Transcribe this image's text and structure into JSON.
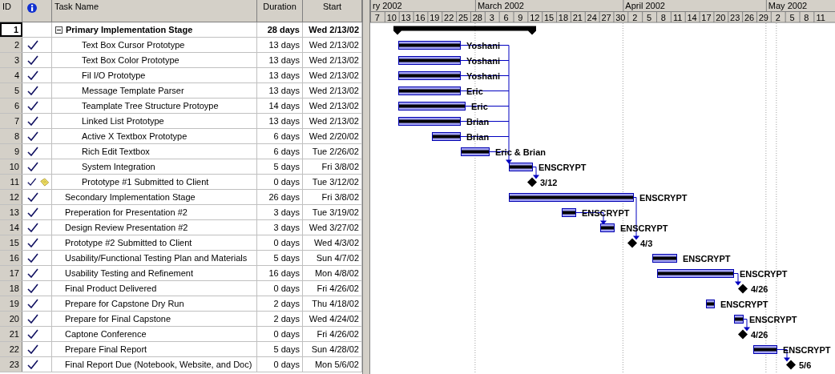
{
  "columns": {
    "id": "ID",
    "name": "Task Name",
    "duration": "Duration",
    "start": "Start"
  },
  "timescale": {
    "months": [
      "ry 2002",
      "March 2002",
      "April 2002",
      "May 2002"
    ],
    "days": [
      "7",
      "10",
      "13",
      "16",
      "19",
      "22",
      "25",
      "28",
      "3",
      "6",
      "9",
      "12",
      "15",
      "18",
      "21",
      "24",
      "27",
      "30",
      "2",
      "5",
      "8",
      "11",
      "14",
      "17",
      "20",
      "23",
      "26",
      "29",
      "2",
      "5",
      "8",
      "11"
    ]
  },
  "tasks": [
    {
      "id": "1",
      "name": "Primary Implementation Stage",
      "duration": "28 days",
      "start": "Wed 2/13/02",
      "kind": "summary",
      "selected": true,
      "complete": false,
      "note": false,
      "expanded": true,
      "children": [
        {
          "id": "2",
          "name": "Text Box Cursor Prototype",
          "duration": "13 days",
          "start": "Wed 2/13/02",
          "kind": "task",
          "selected": false,
          "complete": true,
          "note": false,
          "bar_label": "Yoshani"
        },
        {
          "id": "3",
          "name": "Text Box Color Prototype",
          "duration": "13 days",
          "start": "Wed 2/13/02",
          "kind": "task",
          "selected": false,
          "complete": true,
          "note": false,
          "bar_label": "Yoshani"
        },
        {
          "id": "4",
          "name": "Fil I/O Prototype",
          "duration": "13 days",
          "start": "Wed 2/13/02",
          "kind": "task",
          "selected": false,
          "complete": true,
          "note": false,
          "bar_label": "Yoshani"
        },
        {
          "id": "5",
          "name": "Message Template Parser",
          "duration": "13 days",
          "start": "Wed 2/13/02",
          "kind": "task",
          "selected": false,
          "complete": true,
          "note": false,
          "bar_label": "Eric"
        },
        {
          "id": "6",
          "name": "Teamplate Tree Structure Protoype",
          "duration": "14 days",
          "start": "Wed 2/13/02",
          "kind": "task",
          "selected": false,
          "complete": true,
          "note": false,
          "bar_label": "Eric"
        },
        {
          "id": "7",
          "name": "Linked List Prototype",
          "duration": "13 days",
          "start": "Wed 2/13/02",
          "kind": "task",
          "selected": false,
          "complete": true,
          "note": false,
          "bar_label": "Brian"
        },
        {
          "id": "8",
          "name": "Active X Textbox Prototype",
          "duration": "6 days",
          "start": "Wed 2/20/02",
          "kind": "task",
          "selected": false,
          "complete": true,
          "note": false,
          "bar_label": "Brian"
        },
        {
          "id": "9",
          "name": "Rich Edit Textbox",
          "duration": "6 days",
          "start": "Tue 2/26/02",
          "kind": "task",
          "selected": false,
          "complete": true,
          "note": false,
          "bar_label": "Eric & Brian"
        },
        {
          "id": "10",
          "name": "System Integration",
          "duration": "5 days",
          "start": "Fri 3/8/02",
          "kind": "task",
          "selected": false,
          "complete": true,
          "note": false,
          "bar_label": "ENSCRYPT"
        },
        {
          "id": "11",
          "name": "Prototype #1 Submitted to Client",
          "duration": "0 days",
          "start": "Tue 3/12/02",
          "kind": "milestone",
          "selected": false,
          "complete": true,
          "note": true,
          "bar_label": "3/12"
        }
      ]
    },
    {
      "id": "12",
      "name": "Secondary Implementation Stage",
      "duration": "26 days",
      "start": "Fri 3/8/02",
      "kind": "task",
      "selected": false,
      "complete": true,
      "note": false,
      "bar_label": "ENSCRYPT"
    },
    {
      "id": "13",
      "name": "Preperation for Presentation #2",
      "duration": "3 days",
      "start": "Tue 3/19/02",
      "kind": "task",
      "selected": false,
      "complete": true,
      "note": false,
      "bar_label": "ENSCRYPT"
    },
    {
      "id": "14",
      "name": "Design Review Presentation #2",
      "duration": "3 days",
      "start": "Wed 3/27/02",
      "kind": "task",
      "selected": false,
      "complete": true,
      "note": false,
      "bar_label": "ENSCRYPT"
    },
    {
      "id": "15",
      "name": "Prototype #2 Submitted to Client",
      "duration": "0 days",
      "start": "Wed 4/3/02",
      "kind": "milestone",
      "selected": false,
      "complete": true,
      "note": false,
      "bar_label": "4/3"
    },
    {
      "id": "16",
      "name": "Usability/Functional Testing Plan and Materials",
      "duration": "5 days",
      "start": "Sun 4/7/02",
      "kind": "task",
      "selected": false,
      "complete": true,
      "note": false,
      "bar_label": "ENSCRYPT"
    },
    {
      "id": "17",
      "name": "Usability Testing and Refinement",
      "duration": "16 days",
      "start": "Mon 4/8/02",
      "kind": "task",
      "selected": false,
      "complete": true,
      "note": false,
      "bar_label": "ENSCRYPT"
    },
    {
      "id": "18",
      "name": "Final Product Delivered",
      "duration": "0 days",
      "start": "Fri 4/26/02",
      "kind": "milestone",
      "selected": false,
      "complete": true,
      "note": false,
      "bar_label": "4/26"
    },
    {
      "id": "19",
      "name": "Prepare for Capstone Dry Run",
      "duration": "2 days",
      "start": "Thu 4/18/02",
      "kind": "task",
      "selected": false,
      "complete": true,
      "note": false,
      "bar_label": "ENSCRYPT"
    },
    {
      "id": "20",
      "name": "Prepare for Final Capstone",
      "duration": "2 days",
      "start": "Wed 4/24/02",
      "kind": "task",
      "selected": false,
      "complete": true,
      "note": false,
      "bar_label": "ENSCRYPT"
    },
    {
      "id": "21",
      "name": "Captone Conference",
      "duration": "0 days",
      "start": "Fri 4/26/02",
      "kind": "milestone",
      "selected": false,
      "complete": true,
      "note": false,
      "bar_label": "4/26"
    },
    {
      "id": "22",
      "name": "Prepare Final Report",
      "duration": "5 days",
      "start": "Sun 4/28/02",
      "kind": "task",
      "selected": false,
      "complete": true,
      "note": false,
      "bar_label": "ENSCRYPT"
    },
    {
      "id": "23",
      "name": "Final Report Due (Notebook, Website, and Doc)",
      "duration": "0 days",
      "start": "Mon 5/6/02",
      "kind": "milestone",
      "selected": false,
      "complete": true,
      "note": false,
      "bar_label": "5/6"
    }
  ]
}
